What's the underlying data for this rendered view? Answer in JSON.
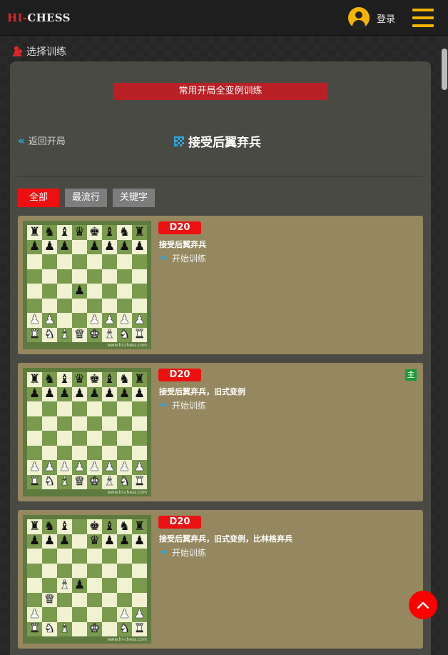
{
  "header": {
    "logo_hi": "HI-",
    "logo_chess": "CHESS",
    "login_label": "登录"
  },
  "section_label": "选择训练",
  "banner_label": "常用开局全变例训练",
  "back_label": "返回开局",
  "page_title": "接受后翼弃兵",
  "filters": [
    {
      "label": "全部",
      "active": true
    },
    {
      "label": "最流行",
      "active": false
    },
    {
      "label": "关键字",
      "active": false
    }
  ],
  "board_watermark": "www.hi-chess.com",
  "cards": [
    {
      "eco": "D20",
      "title": "接受后翼弃兵",
      "start_label": "开始训练",
      "main_tag": "",
      "board": [
        "rnbqkbnr",
        "ppp.pppp",
        "........",
        "........",
        "...p....",
        "........",
        "PP..PPPP",
        "RNBQKBNR"
      ]
    },
    {
      "eco": "D20",
      "title": "接受后翼弃兵，旧式变例",
      "start_label": "开始训练",
      "main_tag": "主",
      "board": [
        "rnbqkbnr",
        "pppppppp",
        "........",
        "........",
        "........",
        "........",
        "PPPPPPPP",
        "RNBQKBNR"
      ]
    },
    {
      "eco": "D20",
      "title": "接受后翼弃兵，旧式变例，比林格弃兵",
      "start_label": "开始训练",
      "main_tag": "",
      "board": [
        "rnb.kbnr",
        "ppp.qppp",
        "........",
        "........",
        "..Bp....",
        ".Q......",
        "P.....PP",
        "RNB.K.NR"
      ]
    }
  ],
  "icons": {
    "user": "user-circle-icon",
    "menu": "hamburger-menu-icon",
    "section": "pawn-icon",
    "back": "double-chevron-left-icon",
    "title": "grid-icon",
    "start": "arrow-right-icon",
    "to_top": "chevron-up-icon"
  },
  "colors": {
    "accent_yellow": "#f5b400",
    "accent_red": "#ee1010",
    "banner_red": "#b82026",
    "link_blue": "#29a8e0",
    "card_bg": "#95875f",
    "panel_bg": "#4a4a45"
  }
}
